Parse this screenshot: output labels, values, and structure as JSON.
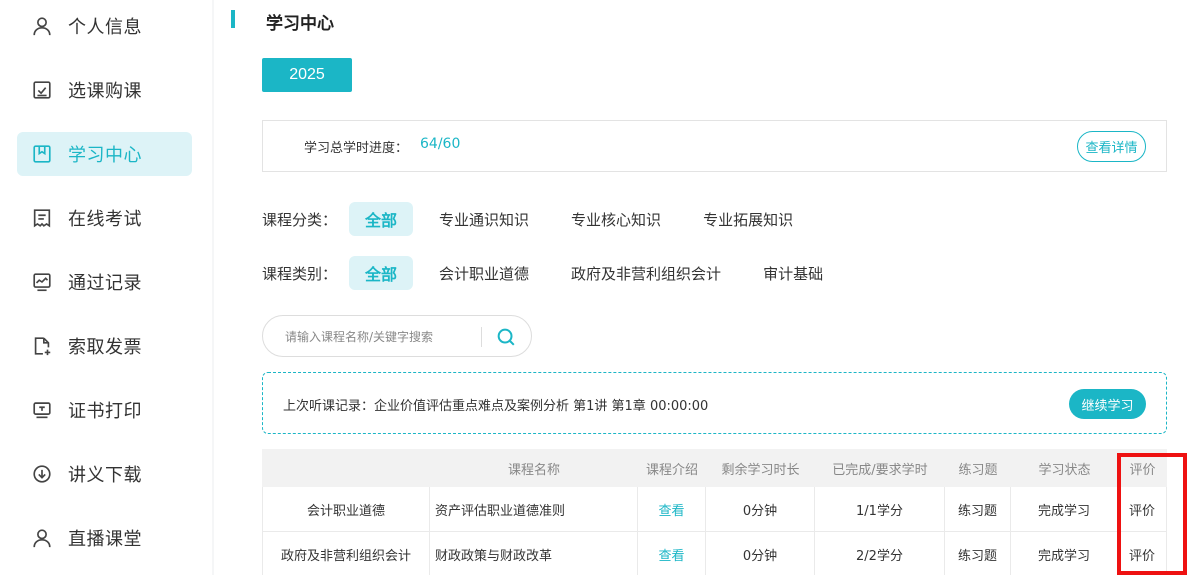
{
  "sidebar": {
    "items": [
      {
        "label": "个人信息",
        "icon": "user-icon"
      },
      {
        "label": "选课购课",
        "icon": "checkbox-icon"
      },
      {
        "label": "学习中心",
        "icon": "bookmark-icon",
        "active": true
      },
      {
        "label": "在线考试",
        "icon": "exam-doc-icon"
      },
      {
        "label": "通过记录",
        "icon": "chart-icon"
      },
      {
        "label": "索取发票",
        "icon": "invoice-add-icon"
      },
      {
        "label": "证书打印",
        "icon": "certificate-icon"
      },
      {
        "label": "讲义下载",
        "icon": "download-icon"
      },
      {
        "label": "直播课堂",
        "icon": "user-icon"
      }
    ]
  },
  "main": {
    "title": "学习中心",
    "year": "2025",
    "progress": {
      "label": "学习总学时进度：",
      "value": "64/60",
      "detail_button": "查看详情"
    },
    "filters": {
      "category": {
        "label": "课程分类：",
        "options": [
          "全部",
          "专业通识知识",
          "专业核心知识",
          "专业拓展知识"
        ],
        "selected": "全部"
      },
      "type": {
        "label": "课程类别：",
        "options": [
          "全部",
          "会计职业道德",
          "政府及非营利组织会计",
          "审计基础"
        ],
        "selected": "全部"
      }
    },
    "search": {
      "placeholder": "请输入课程名称/关键字搜索"
    },
    "last_record": {
      "text": "上次听课记录：企业价值评估重点难点及案例分析 第1讲 第1章 00:00:00",
      "button": "继续学习"
    },
    "table": {
      "columns": [
        "",
        "课程名称",
        "课程介绍",
        "剩余学习时长",
        "已完成/要求学时",
        "练习题",
        "学习状态",
        "评价"
      ],
      "rows": [
        {
          "category": "会计职业道德",
          "name": "资产评估职业道德准则",
          "intro": "查看",
          "remaining": "0分钟",
          "hours": "1/1学分",
          "exercise": "练习题",
          "status": "完成学习",
          "review": "评价"
        },
        {
          "category": "政府及非营利组织会计",
          "name": "财政政策与财政改革",
          "intro": "查看",
          "remaining": "0分钟",
          "hours": "2/2学分",
          "exercise": "练习题",
          "status": "完成学习",
          "review": "评价"
        }
      ]
    }
  },
  "colors": {
    "accent": "#1bb6c6",
    "accent_light": "#ddf3f7",
    "highlight": "#ee1111"
  }
}
